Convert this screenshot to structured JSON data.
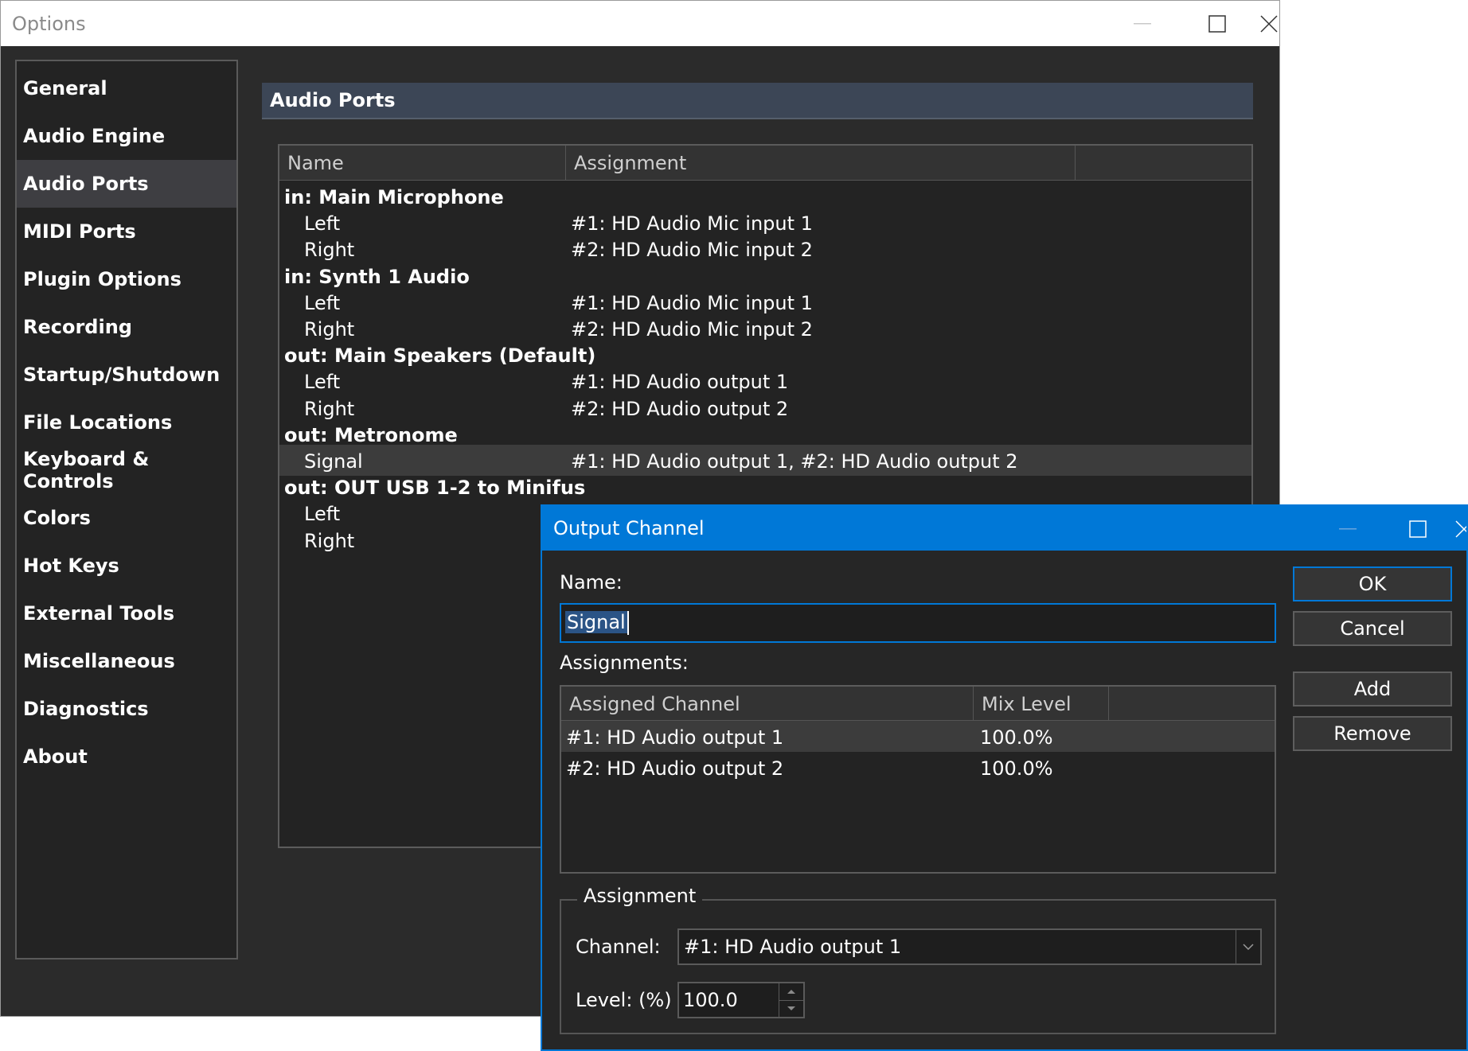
{
  "options_window": {
    "title": "Options",
    "sidebar": {
      "items": [
        {
          "label": "General"
        },
        {
          "label": "Audio Engine"
        },
        {
          "label": "Audio Ports",
          "selected": true
        },
        {
          "label": "MIDI Ports"
        },
        {
          "label": "Plugin Options"
        },
        {
          "label": "Recording"
        },
        {
          "label": "Startup/Shutdown"
        },
        {
          "label": "File Locations"
        },
        {
          "label": "Keyboard & Controls"
        },
        {
          "label": "Colors"
        },
        {
          "label": "Hot Keys"
        },
        {
          "label": "External Tools"
        },
        {
          "label": "Miscellaneous"
        },
        {
          "label": "Diagnostics"
        },
        {
          "label": "About"
        }
      ]
    },
    "section_title": "Audio Ports",
    "ports_table": {
      "columns": [
        "Name",
        "Assignment"
      ],
      "rows": [
        {
          "type": "group",
          "name": "in: Main Microphone",
          "assignment": ""
        },
        {
          "type": "channel",
          "name": "Left",
          "assignment": "#1: HD Audio Mic input 1"
        },
        {
          "type": "channel",
          "name": "Right",
          "assignment": "#2: HD Audio Mic input 2"
        },
        {
          "type": "group",
          "name": "in: Synth 1 Audio",
          "assignment": ""
        },
        {
          "type": "channel",
          "name": "Left",
          "assignment": "#1: HD Audio Mic input 1"
        },
        {
          "type": "channel",
          "name": "Right",
          "assignment": "#2: HD Audio Mic input 2"
        },
        {
          "type": "group",
          "name": "out: Main Speakers (Default)",
          "assignment": ""
        },
        {
          "type": "channel",
          "name": "Left",
          "assignment": "#1: HD Audio output 1"
        },
        {
          "type": "channel",
          "name": "Right",
          "assignment": "#2: HD Audio output 2"
        },
        {
          "type": "group",
          "name": "out: Metronome",
          "assignment": ""
        },
        {
          "type": "channel",
          "name": "Signal",
          "assignment": "#1: HD Audio output 1, #2: HD Audio output 2",
          "selected": true
        },
        {
          "type": "group",
          "name": "out: OUT USB 1-2 to Minifus",
          "assignment": ""
        },
        {
          "type": "channel",
          "name": "Left",
          "assignment": ""
        },
        {
          "type": "channel",
          "name": "Right",
          "assignment": ""
        }
      ]
    }
  },
  "dialog": {
    "title": "Output Channel",
    "name_label": "Name:",
    "name_value": "Signal",
    "assignments_label": "Assignments:",
    "assignments_table": {
      "columns": [
        "Assigned Channel",
        "Mix Level"
      ],
      "rows": [
        {
          "channel": "#1: HD Audio output 1",
          "level": "100.0%",
          "selected": true
        },
        {
          "channel": "#2: HD Audio output 2",
          "level": "100.0%"
        }
      ]
    },
    "buttons": {
      "ok": "OK",
      "cancel": "Cancel",
      "add": "Add",
      "remove": "Remove"
    },
    "assignment_group": {
      "title": "Assignment",
      "channel_label": "Channel:",
      "channel_value": "#1: HD Audio output 1",
      "level_label": "Level: (%)",
      "level_value": "100.0"
    }
  },
  "colors": {
    "accent": "#0078d7",
    "window_bg": "#2b2b2b",
    "panel_bg": "#232323",
    "selection": "#3c3c3c"
  }
}
